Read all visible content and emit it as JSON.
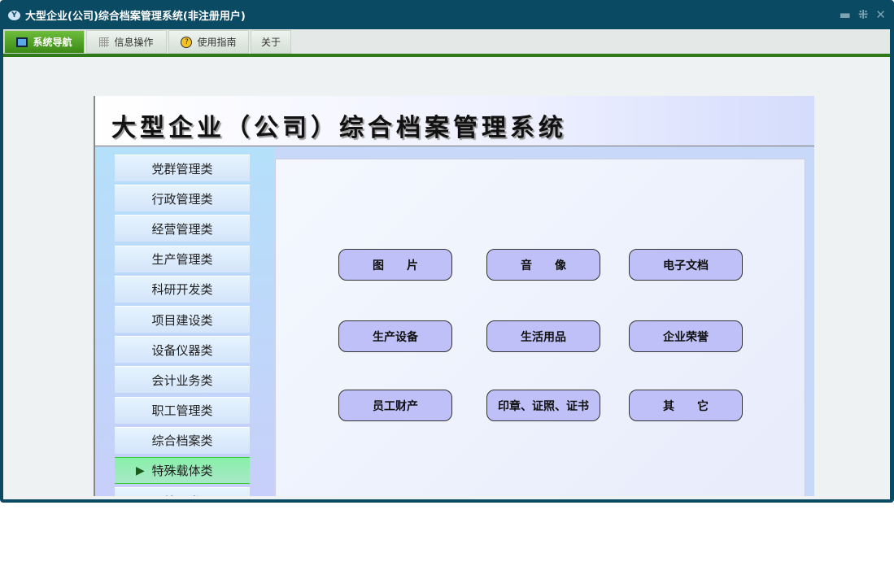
{
  "window": {
    "title": "大型企业(公司)综合档案管理系统(非注册用户)",
    "logo": "Y"
  },
  "controls": {
    "minimize": "▬",
    "restore": "⁜",
    "close": "✕"
  },
  "tabs": [
    {
      "label": "系统导航",
      "icon": "monitor-icon"
    },
    {
      "label": "信息操作",
      "icon": "grid-icon"
    },
    {
      "label": "使用指南",
      "icon": "help-icon"
    },
    {
      "label": "关于"
    }
  ],
  "header": {
    "title": "大型企业（公司）综合档案管理系统"
  },
  "sidebar": {
    "items": [
      "党群管理类",
      "行政管理类",
      "经营管理类",
      "生产管理类",
      "科研开发类",
      "项目建设类",
      "设备仪器类",
      "会计业务类",
      "职工管理类",
      "综合档案类",
      "特殊载体类",
      "编研类"
    ],
    "selected": "特殊载体类"
  },
  "buttons": [
    "图　　片",
    "音　　像",
    "电子文档",
    "生产设备",
    "生活用品",
    "企业荣誉",
    "员工财产",
    "印章、证照、证书",
    "其　　它"
  ]
}
